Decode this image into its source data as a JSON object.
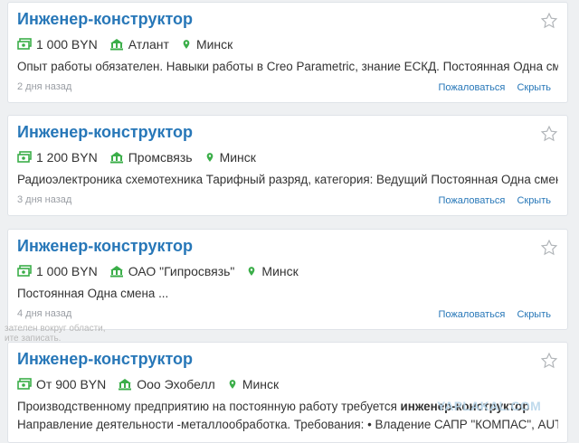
{
  "colors": {
    "accent": "#2777b8",
    "salary_icon": "#3bae49",
    "location_icon": "#3bae49"
  },
  "listings": [
    {
      "title": "Инженер-конструктор",
      "salary": "1 000 BYN",
      "company": "Атлант",
      "city": "Минск",
      "description": "Опыт работы обязателен. Навыки работы в Creo Parametric, знание ЕСКД. Постоянная Одна смена ...",
      "posted": "2 дня назад",
      "report_label": "Пожаловаться",
      "hide_label": "Скрыть"
    },
    {
      "title": "Инженер-конструктор",
      "salary": "1 200 BYN",
      "company": "Промсвязь",
      "city": "Минск",
      "description": "Радиоэлектроника схемотехника Тарифный разряд, категория: Ведущий Постоянная Одна смена ...",
      "posted": "3 дня назад",
      "report_label": "Пожаловаться",
      "hide_label": "Скрыть"
    },
    {
      "title": "Инженер-конструктор",
      "salary": "1 000 BYN",
      "company": "ОАО \"Гипросвязь\"",
      "city": "Минск",
      "description": "Постоянная Одна смена ...",
      "posted": "4 дня назад",
      "report_label": "Пожаловаться",
      "hide_label": "Скрыть"
    },
    {
      "title": "Инженер-конструктор",
      "salary": "От 900 BYN",
      "company": "Ооо Эхобелл",
      "city": "Минск",
      "description_before": "Производственному предприятию на постоянную работу требуется ",
      "description_bold": "инженер-конструктор",
      "description_line2": "Направление деятельности -металлообработка. Требования: • Владение САПР \"КОМПАС\", AUTOCAD."
    }
  ],
  "overlay_hints": {
    "line1": "зателен вокруг области,",
    "line2": "ите записать."
  },
  "watermark": "YAPLAKAL.COM"
}
